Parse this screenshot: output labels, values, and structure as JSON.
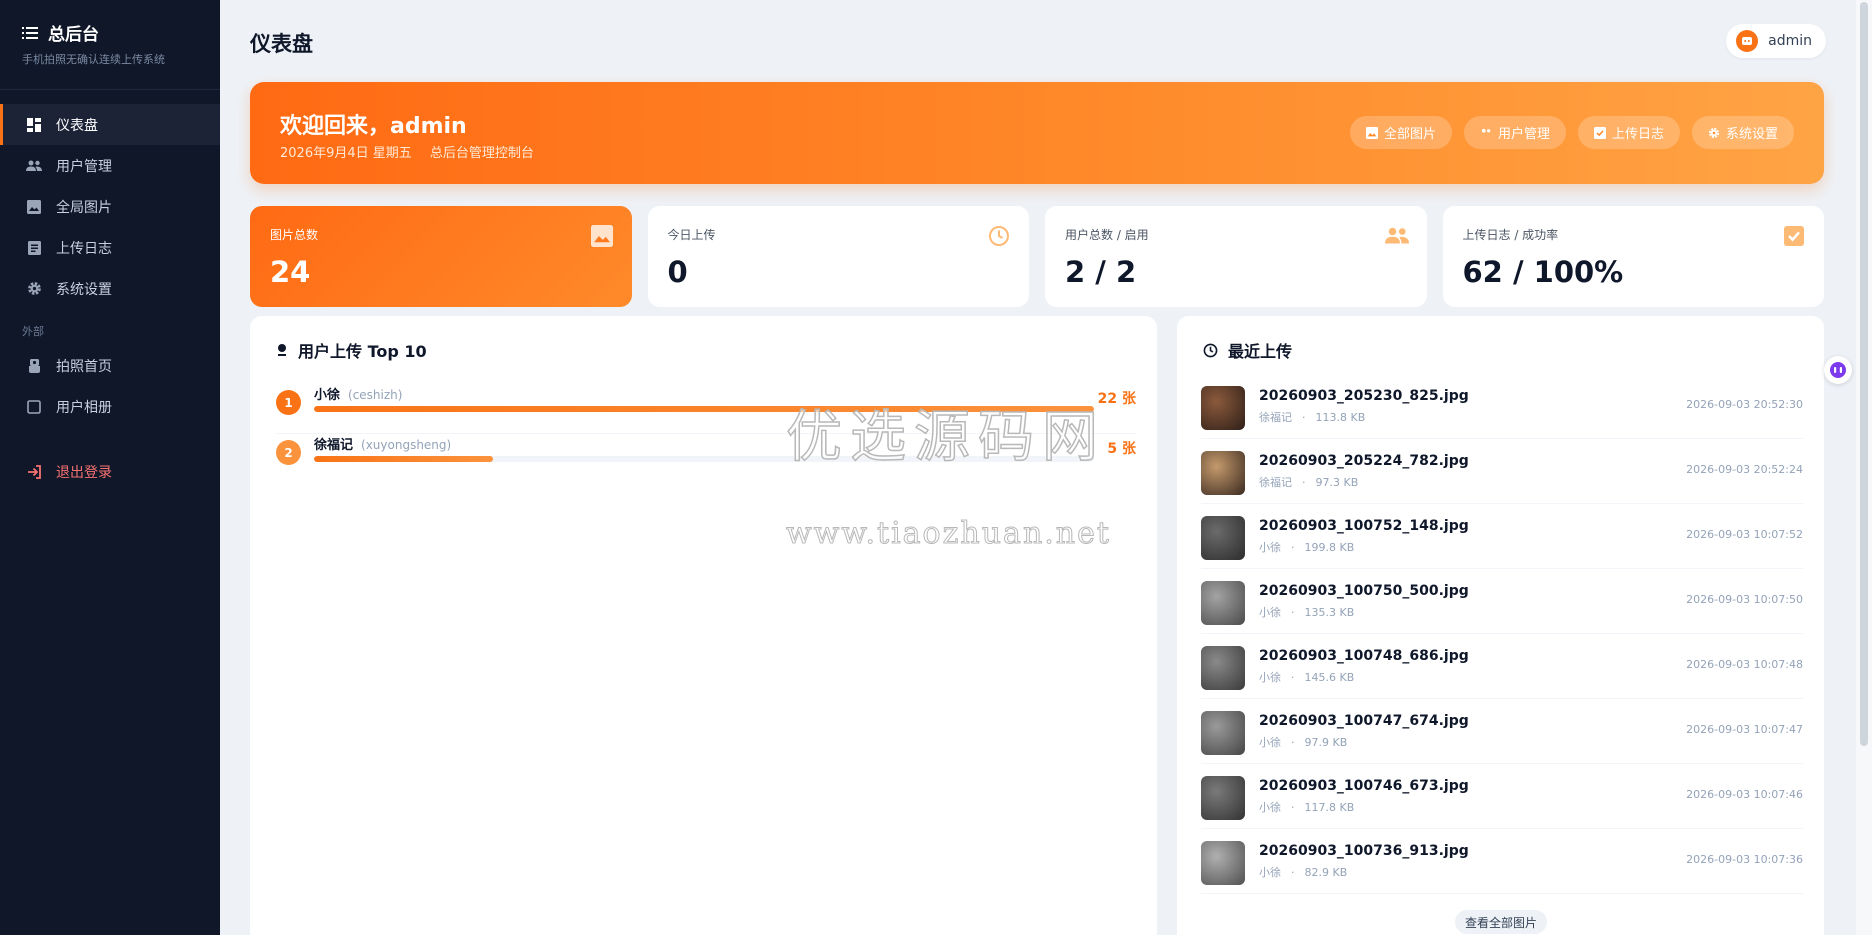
{
  "sidebar": {
    "title": "总后台",
    "subtitle": "手机拍照无确认连续上传系统",
    "items": [
      {
        "label": "仪表盘",
        "icon": "dashboard-icon"
      },
      {
        "label": "用户管理",
        "icon": "users-icon"
      },
      {
        "label": "全局图片",
        "icon": "image-icon"
      },
      {
        "label": "上传日志",
        "icon": "log-icon"
      },
      {
        "label": "系统设置",
        "icon": "gear-icon"
      }
    ],
    "section_external": "外部",
    "external_items": [
      {
        "label": "拍照首页",
        "icon": "camera-hand-icon"
      },
      {
        "label": "用户相册",
        "icon": "album-icon"
      }
    ],
    "logout": "退出登录",
    "accent": "#f97316"
  },
  "header": {
    "title": "仪表盘",
    "user": "admin"
  },
  "banner": {
    "title": "欢迎回来，admin",
    "date": "2026年9月4日 星期五",
    "subtitle": "总后台管理控制台",
    "buttons": [
      {
        "label": "全部图片",
        "icon": "image-icon"
      },
      {
        "label": "用户管理",
        "icon": "users-icon"
      },
      {
        "label": "上传日志",
        "icon": "check-square-icon"
      },
      {
        "label": "系统设置",
        "icon": "gear-icon"
      }
    ]
  },
  "stats": [
    {
      "label": "图片总数",
      "value": "24",
      "icon": "image-icon"
    },
    {
      "label": "今日上传",
      "value": "0",
      "icon": "clock-icon"
    },
    {
      "label": "用户总数 / 启用",
      "value": "2 / 2",
      "icon": "users-icon"
    },
    {
      "label": "上传日志 / 成功率",
      "value": "62 / 100%",
      "icon": "check-square-icon"
    }
  ],
  "top_users": {
    "title": "用户上传 Top 10",
    "rows": [
      {
        "rank": "1",
        "name": "小徐",
        "username": "(ceshizh)",
        "count": "22 张",
        "share": 1.0
      },
      {
        "rank": "2",
        "name": "徐福记",
        "username": "(xuyongsheng)",
        "count": "5 张",
        "share": 0.23
      }
    ]
  },
  "recent": {
    "title": "最近上传",
    "items": [
      {
        "name": "20260903_205230_825.jpg",
        "user": "徐福记",
        "size": "113.8 KB",
        "time": "2026-09-03 20:52:30"
      },
      {
        "name": "20260903_205224_782.jpg",
        "user": "徐福记",
        "size": "97.3 KB",
        "time": "2026-09-03 20:52:24"
      },
      {
        "name": "20260903_100752_148.jpg",
        "user": "小徐",
        "size": "199.8 KB",
        "time": "2026-09-03 10:07:52"
      },
      {
        "name": "20260903_100750_500.jpg",
        "user": "小徐",
        "size": "135.3 KB",
        "time": "2026-09-03 10:07:50"
      },
      {
        "name": "20260903_100748_686.jpg",
        "user": "小徐",
        "size": "145.6 KB",
        "time": "2026-09-03 10:07:48"
      },
      {
        "name": "20260903_100747_674.jpg",
        "user": "小徐",
        "size": "97.9 KB",
        "time": "2026-09-03 10:07:47"
      },
      {
        "name": "20260903_100746_673.jpg",
        "user": "小徐",
        "size": "117.8 KB",
        "time": "2026-09-03 10:07:46"
      },
      {
        "name": "20260903_100736_913.jpg",
        "user": "小徐",
        "size": "82.9 KB",
        "time": "2026-09-03 10:07:36"
      }
    ],
    "view_all": "查看全部图片"
  },
  "watermark": {
    "line1": "优选源码网",
    "line2": "www.tiaozhuan.net"
  }
}
